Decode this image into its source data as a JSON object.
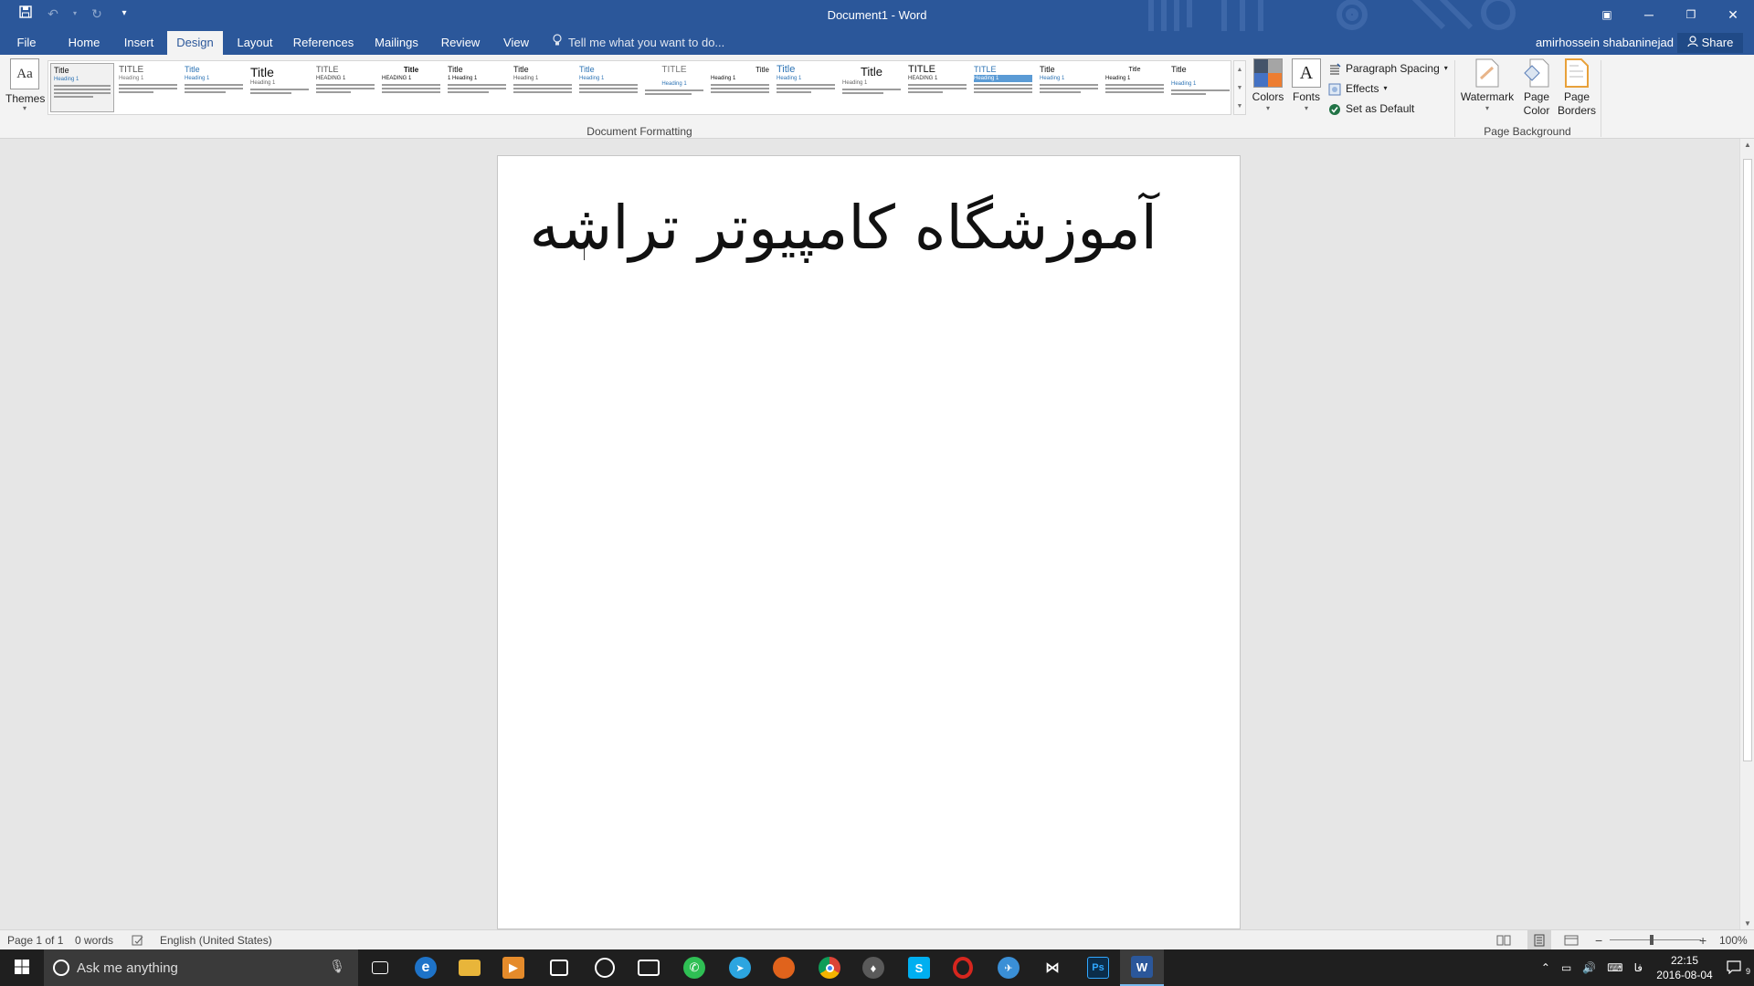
{
  "window": {
    "title": "Document1 - Word",
    "restore_icon": "restore-icon",
    "ribbon_display_icon": "ribbon-display-options-icon"
  },
  "quick_access": {
    "save": "save-icon",
    "undo": "undo-icon",
    "redo": "redo-icon",
    "customize": "customize-qat-icon"
  },
  "tabs": [
    {
      "label": "File"
    },
    {
      "label": "Home"
    },
    {
      "label": "Insert"
    },
    {
      "label": "Design"
    },
    {
      "label": "Layout"
    },
    {
      "label": "References"
    },
    {
      "label": "Mailings"
    },
    {
      "label": "Review"
    },
    {
      "label": "View"
    }
  ],
  "active_tab": "Design",
  "tell_me": {
    "placeholder": "Tell me what you want to do..."
  },
  "user": {
    "name": "amirhossein shabaninejad"
  },
  "share": {
    "label": "Share"
  },
  "ribbon": {
    "themes_label": "Themes",
    "themes_icon_text": "Aa",
    "style_set": [
      {
        "title": "Title",
        "heading": "Heading 1"
      },
      {
        "title": "TITLE",
        "heading": "Heading 1"
      },
      {
        "title": "Title",
        "heading": "Heading 1"
      },
      {
        "title": "Title",
        "heading": "Heading 1"
      },
      {
        "title": "TITLE",
        "heading": "HEADING 1"
      },
      {
        "title": "Title",
        "heading": "HEADING 1"
      },
      {
        "title": "Title",
        "heading": "1 Heading 1"
      },
      {
        "title": "Title",
        "heading": "Heading 1"
      },
      {
        "title": "Title",
        "heading": "Heading 1"
      },
      {
        "title": "TITLE",
        "heading": "Heading 1"
      },
      {
        "title": "Title",
        "heading": "Heading 1"
      },
      {
        "title": "Title",
        "heading": "Heading 1"
      },
      {
        "title": "Title",
        "heading": "Heading 1"
      },
      {
        "title": "TITLE",
        "heading": "HEADING 1"
      },
      {
        "title": "TITLE",
        "heading": "Heading 1"
      },
      {
        "title": "Title",
        "heading": "Heading 1"
      },
      {
        "title": "Title",
        "heading": "Heading 1"
      },
      {
        "title": "Title",
        "heading": "Heading 1"
      }
    ],
    "document_formatting_label": "Document Formatting",
    "colors_label": "Colors",
    "fonts_label": "Fonts",
    "fonts_icon_text": "A",
    "paragraph_spacing_label": "Paragraph Spacing",
    "effects_label": "Effects",
    "set_default_label": "Set as Default",
    "watermark_label": "Watermark",
    "page_color_label": "Page Color",
    "page_borders_label": "Page Borders",
    "page_background_label": "Page Background"
  },
  "document": {
    "text": "آموزشگاه کامپیوتر تراشه"
  },
  "status_bar": {
    "page": "Page 1 of 1",
    "words": "0 words",
    "language": "English (United States)",
    "zoom": "100%"
  },
  "taskbar": {
    "search_placeholder": "Ask me anything",
    "language_indicator": "فا",
    "time": "22:15",
    "date": "2016-08-04",
    "notifications_count": "9",
    "apps": [
      {
        "name": "task-view-icon",
        "glyph": "▭",
        "color": "#1f1f1f"
      },
      {
        "name": "edge-icon",
        "glyph": "e",
        "color": "#1e73c8"
      },
      {
        "name": "file-explorer-icon",
        "glyph": "▬",
        "color": "#e8b53a"
      },
      {
        "name": "media-icon",
        "glyph": "▶",
        "color": "#e58b2b"
      },
      {
        "name": "store-icon",
        "glyph": "◼",
        "color": "#333333"
      },
      {
        "name": "groove-icon",
        "glyph": "◎",
        "color": "#1f1f1f"
      },
      {
        "name": "movies-icon",
        "glyph": "▣",
        "color": "#1f1f1f"
      },
      {
        "name": "whatsapp-icon",
        "glyph": "✆",
        "color": "#2fbf54"
      },
      {
        "name": "telegram-icon",
        "glyph": "➤",
        "color": "#2ca5e0"
      },
      {
        "name": "firefox-icon",
        "glyph": "●",
        "color": "#e0631c"
      },
      {
        "name": "chrome-icon",
        "glyph": "◉",
        "color": "#2f9e44"
      },
      {
        "name": "app-icon",
        "glyph": "♦",
        "color": "#5a5a5a"
      },
      {
        "name": "skype-icon",
        "glyph": "S",
        "color": "#00aff0"
      },
      {
        "name": "opera-icon",
        "glyph": "O",
        "color": "#d7261e"
      },
      {
        "name": "messenger-icon",
        "glyph": "✈",
        "color": "#3a8fd6"
      },
      {
        "name": "visual-studio-icon",
        "glyph": "⋈",
        "color": "#5c2d91"
      },
      {
        "name": "photoshop-icon",
        "glyph": "Ps",
        "color": "#0b2d4a"
      },
      {
        "name": "word-icon",
        "glyph": "W",
        "color": "#2b579a"
      }
    ]
  },
  "colors": {
    "word_blue": "#2b579a",
    "ribbon_bg": "#f3f3f3",
    "canvas_bg": "#e6e6e6",
    "taskbar_bg": "#1f1f1f"
  }
}
